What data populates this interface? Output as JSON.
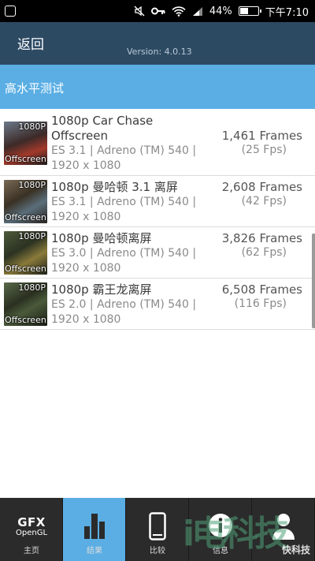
{
  "status": {
    "battery": "44%",
    "time": "下午7:10"
  },
  "header": {
    "back_label": "返回",
    "version": "Version: 4.0.13"
  },
  "section": {
    "title": "高水平测试"
  },
  "tests": [
    {
      "name": "1080p Car Chase",
      "name2": "Offscreen",
      "desc1": "ES 3.1 | Adreno (TM) 540 |",
      "desc2": "1920 x 1080",
      "frames": "1,461 Frames",
      "fps": "(25 Fps)",
      "thumb_top": "1080P",
      "thumb_bottom": "Offscreen"
    },
    {
      "name": "1080p 曼哈顿 3.1 离屏",
      "desc1": "ES 3.1 | Adreno (TM) 540 |",
      "desc2": "1920 x 1080",
      "frames": "2,608 Frames",
      "fps": "(42 Fps)",
      "thumb_top": "1080P",
      "thumb_bottom": "Offscreen"
    },
    {
      "name": "1080p 曼哈顿离屏",
      "desc1": "ES 3.0 | Adreno (TM) 540 |",
      "desc2": "1920 x 1080",
      "frames": "3,826 Frames",
      "fps": "(62 Fps)",
      "thumb_top": "1080P",
      "thumb_bottom": "Offscreen"
    },
    {
      "name": "1080p 霸王龙离屏",
      "desc1": "ES 2.0 | Adreno (TM) 540 |",
      "desc2": "1920 x 1080",
      "frames": "6,508 Frames",
      "fps": "(116 Fps)",
      "thumb_top": "1080P",
      "thumb_bottom": "Offscreen"
    }
  ],
  "nav": {
    "home_logo": "GFX",
    "home_logo_sub": "OpenGL",
    "home": "主页",
    "results": "结果",
    "compare": "比较",
    "info": "信息",
    "settings": ""
  },
  "watermark": {
    "big": "i电科技",
    "small": "快科技"
  },
  "colors": {
    "header": "#2d4a63",
    "accent": "#5aaee4",
    "navbar": "#2b2b2b"
  }
}
